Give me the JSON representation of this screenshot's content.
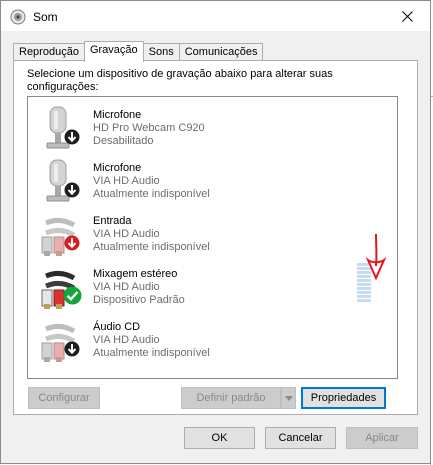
{
  "window": {
    "title": "Som"
  },
  "tabs": [
    {
      "label": "Reprodução",
      "active": false
    },
    {
      "label": "Gravação",
      "active": true
    },
    {
      "label": "Sons",
      "active": false
    },
    {
      "label": "Comunicações",
      "active": false
    }
  ],
  "instructions": "Selecione um dispositivo de gravação abaixo para alterar suas configurações:",
  "devices": [
    {
      "name": "Microfone",
      "driver": "HD Pro Webcam C920",
      "status": "Desabilitado",
      "icon": "microphone-icon",
      "badge": "down-arrow-badge-icon"
    },
    {
      "name": "Microfone",
      "driver": "VIA HD Audio",
      "status": "Atualmente indisponível",
      "icon": "microphone-icon",
      "badge": "down-arrow-badge-icon"
    },
    {
      "name": "Entrada",
      "driver": "VIA HD Audio",
      "status": "Atualmente indisponível",
      "icon": "line-in-cable-icon",
      "badge": "red-down-arrow-badge-icon"
    },
    {
      "name": "Mixagem estéreo",
      "driver": "VIA HD Audio",
      "status": "Dispositivo Padrão",
      "icon": "stereo-mix-cable-icon",
      "badge": "green-check-badge-icon"
    },
    {
      "name": "Áudio CD",
      "driver": "VIA HD Audio",
      "status": "Atualmente indisponível",
      "icon": "cd-audio-cable-icon",
      "badge": "down-arrow-badge-icon"
    }
  ],
  "buttons": {
    "configure": "Configurar",
    "set_default": "Definir padrão",
    "properties": "Propriedades",
    "ok": "OK",
    "cancel": "Cancelar",
    "apply": "Aplicar"
  },
  "colors": {
    "accent": "#0078d7",
    "annotation": "#e8141e",
    "check_green": "#14a33c"
  }
}
